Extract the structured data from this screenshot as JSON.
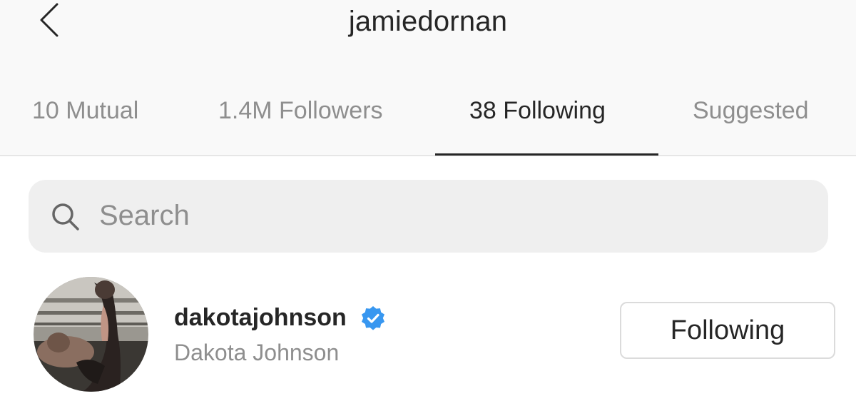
{
  "header": {
    "title": "jamiedornan",
    "back_icon": "chevron-left-icon"
  },
  "tabs": [
    {
      "label": "10 Mutual",
      "active": false
    },
    {
      "label": "1.4M Followers",
      "active": false
    },
    {
      "label": "38 Following",
      "active": true
    },
    {
      "label": "Suggested",
      "active": false
    }
  ],
  "search": {
    "placeholder": "Search",
    "icon": "search-icon"
  },
  "users": [
    {
      "username": "dakotajohnson",
      "full_name": "Dakota Johnson",
      "verified": true,
      "button_label": "Following"
    }
  ],
  "colors": {
    "verified_badge": "#3897f0",
    "secondary_text": "#8e8e8e",
    "primary_text": "#262626",
    "search_bg": "#efefef"
  }
}
